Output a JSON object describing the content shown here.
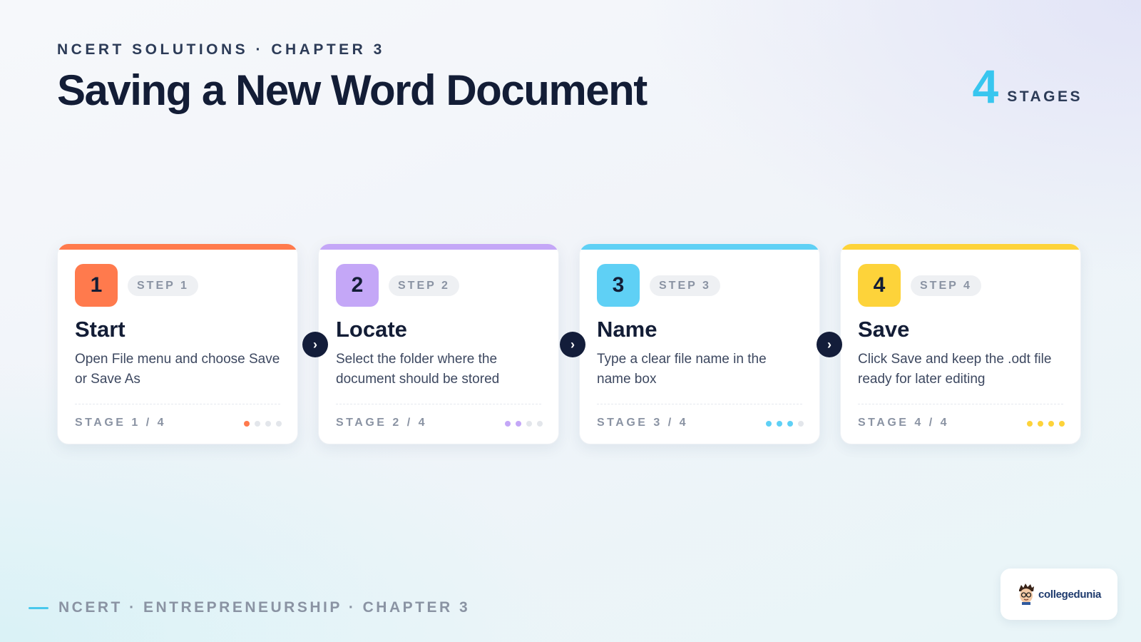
{
  "header": {
    "eyebrow": "NCERT SOLUTIONS · CHAPTER 3",
    "title": "Saving a New Word Document",
    "stage_count": "4",
    "stage_label": "STAGES"
  },
  "cards": [
    {
      "number": "1",
      "step": "STEP 1",
      "title": "Start",
      "description": "Open File menu and choose Save or Save As",
      "stage": "STAGE 1 / 4",
      "accent": "#ff7a4d",
      "badge_color": "#ff7a4d",
      "progress": 1
    },
    {
      "number": "2",
      "step": "STEP 2",
      "title": "Locate",
      "description": "Select the folder where the document should be stored",
      "stage": "STAGE 2 / 4",
      "accent": "#c4a7f7",
      "badge_color": "#c4a7f7",
      "progress": 2
    },
    {
      "number": "3",
      "step": "STEP 3",
      "title": "Name",
      "description": "Type a clear file name in the name box",
      "stage": "STAGE 3 / 4",
      "accent": "#5fd0f5",
      "badge_color": "#5fd0f5",
      "progress": 3
    },
    {
      "number": "4",
      "step": "STEP 4",
      "title": "Save",
      "description": "Click Save and keep the .odt file ready for later editing",
      "stage": "STAGE 4 / 4",
      "accent": "#fdd33a",
      "badge_color": "#fdd33a",
      "progress": 4
    }
  ],
  "connector_icon": "chevron-right-icon",
  "footer": {
    "text": "NCERT · ENTREPRENEURSHIP · CHAPTER 3",
    "accent": "#49c8ec"
  },
  "logo": {
    "text": "collegedunia"
  }
}
